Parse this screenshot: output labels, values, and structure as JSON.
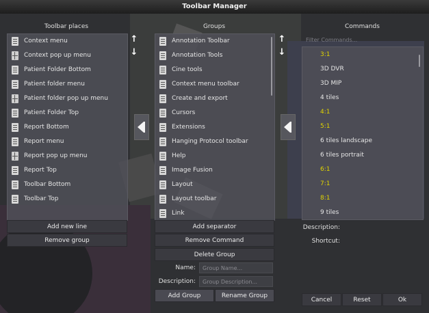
{
  "window": {
    "title": "Toolbar Manager"
  },
  "columns": {
    "toolbar_places": "Toolbar places",
    "groups": "Groups",
    "commands": "Commands"
  },
  "toolbar_places": {
    "items": [
      {
        "label": "Context menu",
        "icon": "list-icon"
      },
      {
        "label": "Context pop up menu",
        "icon": "grid-icon"
      },
      {
        "label": "Patient Folder Bottom",
        "icon": "list-icon"
      },
      {
        "label": "Patient folder menu",
        "icon": "list-icon"
      },
      {
        "label": "Patient folder pop up menu",
        "icon": "grid-icon"
      },
      {
        "label": "Patient Folder Top",
        "icon": "list-icon"
      },
      {
        "label": "Report Bottom",
        "icon": "list-icon"
      },
      {
        "label": "Report menu",
        "icon": "list-icon"
      },
      {
        "label": "Report pop up menu",
        "icon": "grid-icon"
      },
      {
        "label": "Report Top",
        "icon": "list-icon"
      },
      {
        "label": "Toolbar Bottom",
        "icon": "list-icon"
      },
      {
        "label": "Toolbar Top",
        "icon": "list-icon"
      }
    ],
    "add_new_line": "Add new line",
    "remove_group": "Remove group"
  },
  "groups": {
    "items": [
      "Annotation Toolbar",
      "Annotation Tools",
      "Cine tools",
      "Context menu toolbar",
      "Create and export",
      "Cursors",
      "Extensions",
      "Hanging Protocol toolbar",
      "Help",
      "Image Fusion",
      "Layout",
      "Layout toolbar",
      "Link"
    ],
    "add_separator": "Add separator",
    "remove_command": "Remove Command",
    "delete_group": "Delete Group",
    "name_label": "Name:",
    "name_placeholder": "Group Name...",
    "description_label": "Description:",
    "description_placeholder": "Group Description...",
    "add_group": "Add Group",
    "rename_group": "Rename Group"
  },
  "commands": {
    "filter_placeholder": "Filter Commands...",
    "items": [
      {
        "label": "3:1",
        "highlight": true
      },
      {
        "label": "3D DVR",
        "highlight": false
      },
      {
        "label": "3D MIP",
        "highlight": false
      },
      {
        "label": "4 tiles",
        "highlight": false
      },
      {
        "label": "4:1",
        "highlight": true
      },
      {
        "label": "5:1",
        "highlight": true
      },
      {
        "label": "6 tiles landscape",
        "highlight": false
      },
      {
        "label": "6 tiles portrait",
        "highlight": false
      },
      {
        "label": "6:1",
        "highlight": true
      },
      {
        "label": "7:1",
        "highlight": true
      },
      {
        "label": "8:1",
        "highlight": true
      },
      {
        "label": "9 tiles",
        "highlight": false
      }
    ],
    "description_label": "Description:",
    "shortcut_label": "Shortcut:"
  },
  "footer": {
    "cancel": "Cancel",
    "reset": "Reset",
    "ok": "Ok"
  },
  "colors": {
    "highlight": "#e0d400",
    "panel": "#4e4e56",
    "background": "#2f3033"
  }
}
